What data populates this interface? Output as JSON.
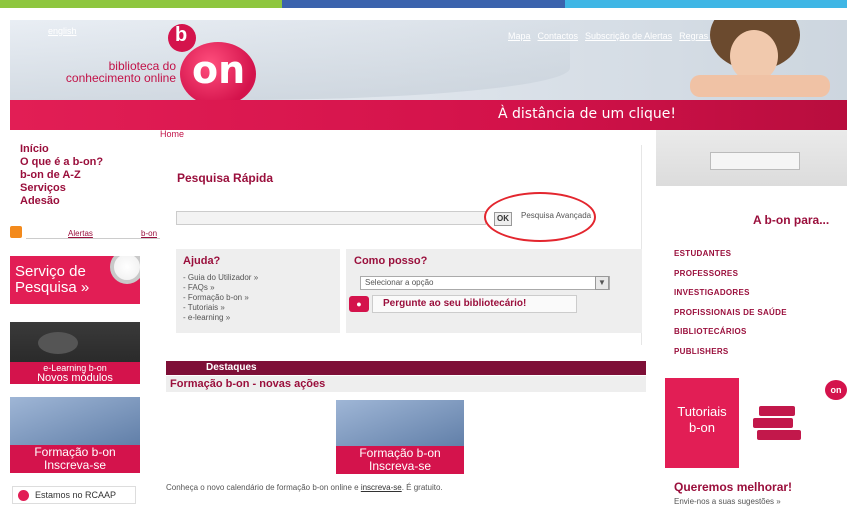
{
  "colors": {
    "strip": [
      "#8ec63f",
      "#3b63ad",
      "#3fb6e5"
    ],
    "brand": "#d4134c",
    "brand_dark": "#9a0f3c"
  },
  "banner": {
    "english": "english",
    "logo_text": "biblioteca do conhecimento online",
    "logo_mark": "on",
    "logo_b": "b",
    "slogan": "À distância de um clique!",
    "top_links": [
      "Mapa",
      "Contactos",
      "Subscrição de Alertas",
      "Regras de utilização"
    ]
  },
  "breadcrumb": "Home",
  "leftnav": [
    "Início",
    "O que é a b-on?",
    "b-on de A-Z",
    "Serviços",
    "Adesão"
  ],
  "alerts": {
    "label1": "Alertas",
    "label2": "b-on"
  },
  "promos": {
    "servico": "Serviço de Pesquisa »",
    "elearning_line1": "e-Learning b-on",
    "elearning_line2": "Novos módulos",
    "formacao_line1": "Formação b-on",
    "formacao_line2": "Inscreva-se",
    "rcaap": "Estamos no RCAAP"
  },
  "search": {
    "title": "Pesquisa Rápida",
    "ok": "OK",
    "advanced": "Pesquisa Avançada"
  },
  "ajuda": {
    "title": "Ajuda?",
    "items": [
      "- Guia do Utilizador »",
      "- FAQs »",
      "- Formação b-on »",
      "- Tutoriais »",
      "- e-learning »"
    ]
  },
  "como": {
    "title": "Como posso?",
    "select": "Selecionar a opção",
    "ask": "Pergunte ao seu bibliotecário!"
  },
  "destaques": {
    "bar": "Destaques",
    "subtitle": "Formação b-on - novas ações",
    "text_pre": "Conheça o novo calendário de formação b-on online e",
    "text_link": "inscreva-se",
    "text_post": ". É gratuito."
  },
  "right": {
    "title": "A b-on para...",
    "audiences": [
      "ESTUDANTES",
      "PROFESSORES",
      "INVESTIGADORES",
      "PROFISSIONAIS DE SAÚDE",
      "BIBLIOTECÁRIOS",
      "PUBLISHERS"
    ],
    "tutoriais_line1": "Tutoriais",
    "tutoriais_line2": "b-on",
    "queremos": "Queremos melhorar!",
    "envie": "Envie-nos a suas sugestões »"
  }
}
